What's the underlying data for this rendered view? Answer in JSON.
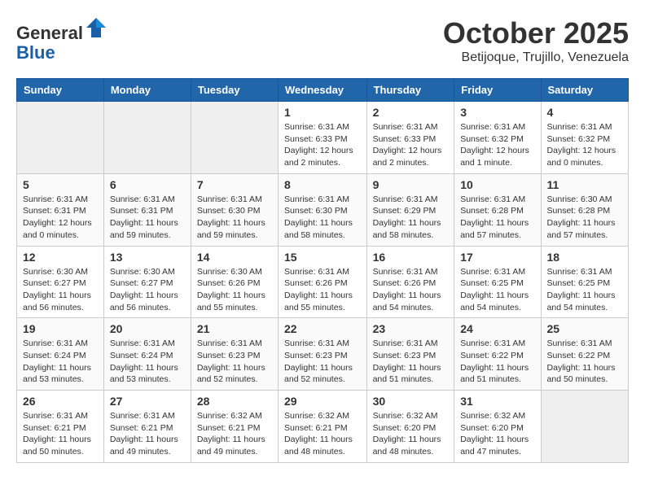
{
  "header": {
    "logo_line1": "General",
    "logo_line2": "Blue",
    "month": "October 2025",
    "location": "Betijoque, Trujillo, Venezuela"
  },
  "weekdays": [
    "Sunday",
    "Monday",
    "Tuesday",
    "Wednesday",
    "Thursday",
    "Friday",
    "Saturday"
  ],
  "weeks": [
    [
      {
        "day": "",
        "info": ""
      },
      {
        "day": "",
        "info": ""
      },
      {
        "day": "",
        "info": ""
      },
      {
        "day": "1",
        "info": "Sunrise: 6:31 AM\nSunset: 6:33 PM\nDaylight: 12 hours\nand 2 minutes."
      },
      {
        "day": "2",
        "info": "Sunrise: 6:31 AM\nSunset: 6:33 PM\nDaylight: 12 hours\nand 2 minutes."
      },
      {
        "day": "3",
        "info": "Sunrise: 6:31 AM\nSunset: 6:32 PM\nDaylight: 12 hours\nand 1 minute."
      },
      {
        "day": "4",
        "info": "Sunrise: 6:31 AM\nSunset: 6:32 PM\nDaylight: 12 hours\nand 0 minutes."
      }
    ],
    [
      {
        "day": "5",
        "info": "Sunrise: 6:31 AM\nSunset: 6:31 PM\nDaylight: 12 hours\nand 0 minutes."
      },
      {
        "day": "6",
        "info": "Sunrise: 6:31 AM\nSunset: 6:31 PM\nDaylight: 11 hours\nand 59 minutes."
      },
      {
        "day": "7",
        "info": "Sunrise: 6:31 AM\nSunset: 6:30 PM\nDaylight: 11 hours\nand 59 minutes."
      },
      {
        "day": "8",
        "info": "Sunrise: 6:31 AM\nSunset: 6:30 PM\nDaylight: 11 hours\nand 58 minutes."
      },
      {
        "day": "9",
        "info": "Sunrise: 6:31 AM\nSunset: 6:29 PM\nDaylight: 11 hours\nand 58 minutes."
      },
      {
        "day": "10",
        "info": "Sunrise: 6:31 AM\nSunset: 6:28 PM\nDaylight: 11 hours\nand 57 minutes."
      },
      {
        "day": "11",
        "info": "Sunrise: 6:30 AM\nSunset: 6:28 PM\nDaylight: 11 hours\nand 57 minutes."
      }
    ],
    [
      {
        "day": "12",
        "info": "Sunrise: 6:30 AM\nSunset: 6:27 PM\nDaylight: 11 hours\nand 56 minutes."
      },
      {
        "day": "13",
        "info": "Sunrise: 6:30 AM\nSunset: 6:27 PM\nDaylight: 11 hours\nand 56 minutes."
      },
      {
        "day": "14",
        "info": "Sunrise: 6:30 AM\nSunset: 6:26 PM\nDaylight: 11 hours\nand 55 minutes."
      },
      {
        "day": "15",
        "info": "Sunrise: 6:31 AM\nSunset: 6:26 PM\nDaylight: 11 hours\nand 55 minutes."
      },
      {
        "day": "16",
        "info": "Sunrise: 6:31 AM\nSunset: 6:26 PM\nDaylight: 11 hours\nand 54 minutes."
      },
      {
        "day": "17",
        "info": "Sunrise: 6:31 AM\nSunset: 6:25 PM\nDaylight: 11 hours\nand 54 minutes."
      },
      {
        "day": "18",
        "info": "Sunrise: 6:31 AM\nSunset: 6:25 PM\nDaylight: 11 hours\nand 54 minutes."
      }
    ],
    [
      {
        "day": "19",
        "info": "Sunrise: 6:31 AM\nSunset: 6:24 PM\nDaylight: 11 hours\nand 53 minutes."
      },
      {
        "day": "20",
        "info": "Sunrise: 6:31 AM\nSunset: 6:24 PM\nDaylight: 11 hours\nand 53 minutes."
      },
      {
        "day": "21",
        "info": "Sunrise: 6:31 AM\nSunset: 6:23 PM\nDaylight: 11 hours\nand 52 minutes."
      },
      {
        "day": "22",
        "info": "Sunrise: 6:31 AM\nSunset: 6:23 PM\nDaylight: 11 hours\nand 52 minutes."
      },
      {
        "day": "23",
        "info": "Sunrise: 6:31 AM\nSunset: 6:23 PM\nDaylight: 11 hours\nand 51 minutes."
      },
      {
        "day": "24",
        "info": "Sunrise: 6:31 AM\nSunset: 6:22 PM\nDaylight: 11 hours\nand 51 minutes."
      },
      {
        "day": "25",
        "info": "Sunrise: 6:31 AM\nSunset: 6:22 PM\nDaylight: 11 hours\nand 50 minutes."
      }
    ],
    [
      {
        "day": "26",
        "info": "Sunrise: 6:31 AM\nSunset: 6:21 PM\nDaylight: 11 hours\nand 50 minutes."
      },
      {
        "day": "27",
        "info": "Sunrise: 6:31 AM\nSunset: 6:21 PM\nDaylight: 11 hours\nand 49 minutes."
      },
      {
        "day": "28",
        "info": "Sunrise: 6:32 AM\nSunset: 6:21 PM\nDaylight: 11 hours\nand 49 minutes."
      },
      {
        "day": "29",
        "info": "Sunrise: 6:32 AM\nSunset: 6:21 PM\nDaylight: 11 hours\nand 48 minutes."
      },
      {
        "day": "30",
        "info": "Sunrise: 6:32 AM\nSunset: 6:20 PM\nDaylight: 11 hours\nand 48 minutes."
      },
      {
        "day": "31",
        "info": "Sunrise: 6:32 AM\nSunset: 6:20 PM\nDaylight: 11 hours\nand 47 minutes."
      },
      {
        "day": "",
        "info": ""
      }
    ]
  ]
}
